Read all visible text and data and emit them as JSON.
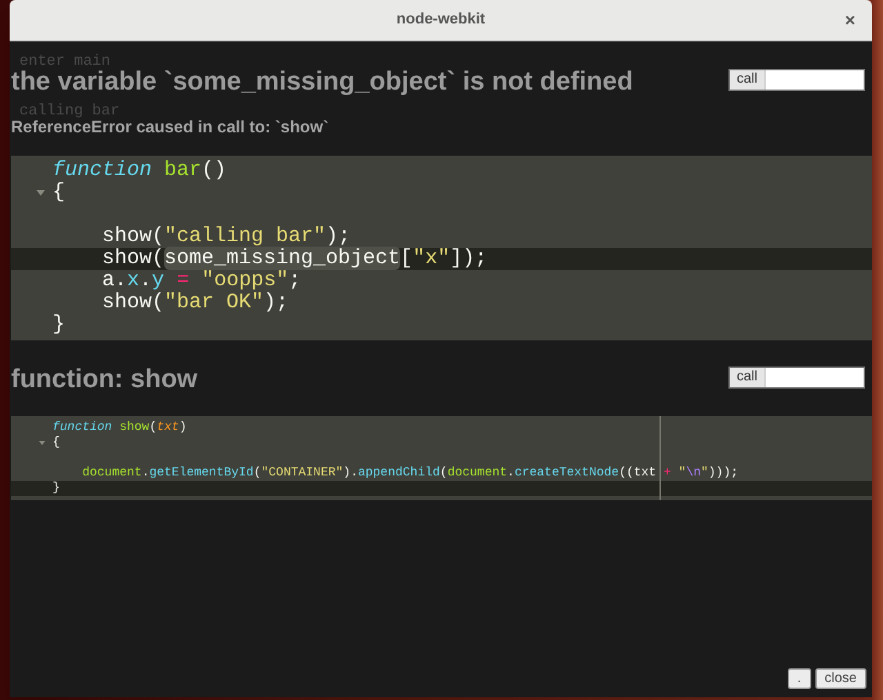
{
  "window": {
    "title": "node-webkit",
    "close": "×"
  },
  "console_log": [
    "enter main",
    "calling bar"
  ],
  "sections": [
    {
      "title": "the variable `some_missing_object` is not defined",
      "subtitle": "ReferenceError caused in call to: `show`",
      "call_button": "call",
      "code": {
        "lines": [
          {
            "active": false,
            "foldable": false,
            "tokens": [
              {
                "kind": "keyword",
                "text": "function "
              },
              {
                "kind": "def",
                "text": "bar"
              },
              {
                "kind": "plain",
                "text": "()"
              }
            ]
          },
          {
            "active": false,
            "foldable": true,
            "tokens": [
              {
                "kind": "plain",
                "text": "{"
              }
            ]
          },
          {
            "active": false,
            "foldable": false
          },
          {
            "active": false,
            "foldable": false,
            "tokens": [
              {
                "kind": "plain",
                "text": "    show("
              },
              {
                "kind": "string",
                "text": "\"calling bar\""
              },
              {
                "kind": "plain",
                "text": ");"
              }
            ]
          },
          {
            "active": true,
            "foldable": false,
            "tokens": [
              {
                "kind": "plain",
                "text": "    show("
              },
              {
                "kind": "match",
                "text": "some_missing_object"
              },
              {
                "kind": "plain",
                "text": "["
              },
              {
                "kind": "string",
                "text": "\"x\""
              },
              {
                "kind": "plain",
                "text": "]);"
              }
            ]
          },
          {
            "active": false,
            "foldable": false,
            "tokens": [
              {
                "kind": "plain",
                "text": "    a."
              },
              {
                "kind": "property",
                "text": "x"
              },
              {
                "kind": "plain",
                "text": "."
              },
              {
                "kind": "property",
                "text": "y"
              },
              {
                "kind": "operator",
                "text": " = "
              },
              {
                "kind": "string",
                "text": "\"oopps\""
              },
              {
                "kind": "plain",
                "text": ";"
              }
            ]
          },
          {
            "active": false,
            "foldable": false,
            "tokens": [
              {
                "kind": "plain",
                "text": "    show("
              },
              {
                "kind": "string",
                "text": "\"bar OK\""
              },
              {
                "kind": "plain",
                "text": ");"
              }
            ]
          },
          {
            "active": false,
            "foldable": false,
            "tokens": [
              {
                "kind": "plain",
                "text": "}"
              }
            ]
          }
        ]
      }
    },
    {
      "title": "function: show",
      "call_button": "call",
      "code": {
        "lines": [
          {
            "active": false,
            "foldable": false,
            "tokens": [
              {
                "kind": "keyword",
                "text": "function "
              },
              {
                "kind": "def",
                "text": "show"
              },
              {
                "kind": "plain",
                "text": "("
              },
              {
                "kind": "param",
                "text": "txt"
              },
              {
                "kind": "plain",
                "text": ")"
              }
            ]
          },
          {
            "active": false,
            "foldable": true,
            "tokens": [
              {
                "kind": "plain",
                "text": "{"
              }
            ]
          },
          {
            "active": false,
            "foldable": false
          },
          {
            "active": false,
            "foldable": false,
            "tokens": [
              {
                "kind": "def",
                "text": "    document"
              },
              {
                "kind": "plain",
                "text": "."
              },
              {
                "kind": "property",
                "text": "getElementById"
              },
              {
                "kind": "plain",
                "text": "("
              },
              {
                "kind": "string",
                "text": "\"CONTAINER\""
              },
              {
                "kind": "plain",
                "text": ")."
              },
              {
                "kind": "property",
                "text": "appendChild"
              },
              {
                "kind": "plain",
                "text": "("
              },
              {
                "kind": "def",
                "text": "document"
              },
              {
                "kind": "plain",
                "text": "."
              },
              {
                "kind": "property",
                "text": "createTextNode"
              },
              {
                "kind": "plain",
                "text": "((txt"
              },
              {
                "kind": "operator",
                "text": " + "
              },
              {
                "kind": "string",
                "text": "\""
              },
              {
                "kind": "escape",
                "text": "\\n"
              },
              {
                "kind": "string",
                "text": "\""
              },
              {
                "kind": "plain",
                "text": ")));"
              }
            ]
          },
          {
            "active": true,
            "foldable": false,
            "tokens": [
              {
                "kind": "plain",
                "text": "}"
              }
            ]
          }
        ]
      }
    }
  ],
  "footer_buttons": [
    ".",
    "close"
  ]
}
